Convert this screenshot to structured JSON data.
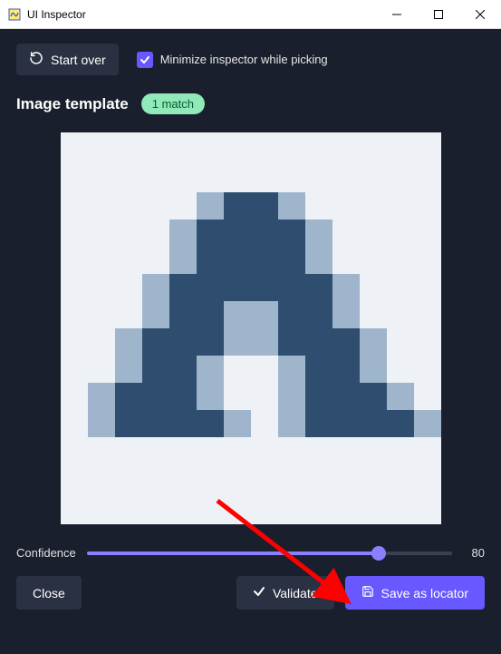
{
  "window": {
    "title": "UI Inspector"
  },
  "toolbar": {
    "start_over": "Start over",
    "minimize_label": "Minimize inspector while picking",
    "minimize_checked": true
  },
  "heading": {
    "title": "Image template",
    "badge": "1 match"
  },
  "confidence": {
    "label": "Confidence",
    "value": "80",
    "percent": 80
  },
  "buttons": {
    "close": "Close",
    "validate": "Validate",
    "save": "Save as locator"
  }
}
